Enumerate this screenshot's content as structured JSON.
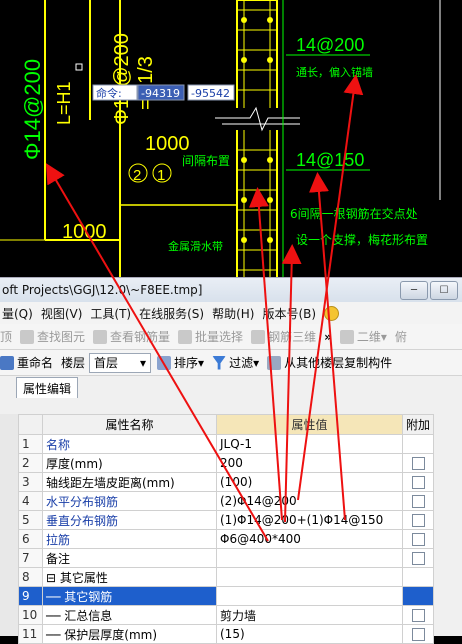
{
  "cad": {
    "labels": {
      "left_vertical": "Φ14@200",
      "lh1": "L=H1",
      "mid_vertical": "Φ14@200",
      "h1_3": "=H1/3",
      "dim_1000_mid": "1000",
      "dim_1000_low": "1000",
      "circ2": "2",
      "circ1": "1",
      "note_mid": "间隔布置",
      "note_gold": "金属滑水带",
      "right_14_200": "14@200",
      "right_note1": "通长，偏入锚墙",
      "right_14_150": "14@150",
      "right_note2": "6间隔一根钢筋在交点处",
      "right_note3": "设一个支撑，梅花形布置"
    },
    "command": {
      "label": "命令:",
      "x_value": "-94319",
      "y_value": "-95542"
    }
  },
  "window": {
    "title": "oft Projects\\GGJ\\12.0\\~F8EE.tmp]",
    "menu": [
      "量(Q)",
      "视图(V)",
      "工具(T)",
      "在线服务(S)",
      "帮助(H)",
      "版本号(B)"
    ],
    "toolbar1": {
      "item0": "顶",
      "find": "查找图元",
      "query": "查看钢筋量",
      "batch": "批量选择",
      "rebar3d": "钢筋三维",
      "more": "»",
      "view_mode": "二维",
      "trailing": "俯"
    },
    "toolbar2": {
      "rename": "重命名",
      "floor_label": "楼层",
      "floor_value": "首层",
      "sort": "排序",
      "filter": "过滤",
      "copy_from": "从其他楼层复制构件"
    },
    "tab": "属性编辑",
    "table": {
      "headers": [
        "",
        "属性名称",
        "属性值",
        "附加"
      ],
      "rows": [
        {
          "num": "1",
          "name": "名称",
          "value": "JLQ-1",
          "check": false
        },
        {
          "num": "2",
          "name": "厚度(mm)",
          "value": "200",
          "check": true
        },
        {
          "num": "3",
          "name": "轴线距左墙皮距离(mm)",
          "value": "(100)",
          "check": true
        },
        {
          "num": "4",
          "name": "水平分布钢筋",
          "value": "(2)Φ14@200",
          "check": true
        },
        {
          "num": "5",
          "name": "垂直分布钢筋",
          "value": "(1)Φ14@200+(1)Φ14@150",
          "check": true
        },
        {
          "num": "6",
          "name": "拉筋",
          "value": "Φ6@400*400",
          "check": true
        },
        {
          "num": "7",
          "name": "备注",
          "value": "",
          "check": true
        },
        {
          "num": "8",
          "name": "⊟ 其它属性",
          "value": "",
          "check": false
        },
        {
          "num": "9",
          "name": "── 其它钢筋",
          "value": "",
          "check": false
        },
        {
          "num": "10",
          "name": "── 汇总信息",
          "value": "剪力墙",
          "check": true
        },
        {
          "num": "11",
          "name": "── 保护层厚度(mm)",
          "value": "(15)",
          "check": true
        }
      ]
    }
  },
  "colors": {
    "cad_yellow": "#ffff00",
    "cad_green": "#00ff00",
    "cad_white": "#ffffff",
    "arrow_red": "#ee1111",
    "name_blue": "#1a3fa8",
    "selection_blue": "#1e5fcc"
  }
}
